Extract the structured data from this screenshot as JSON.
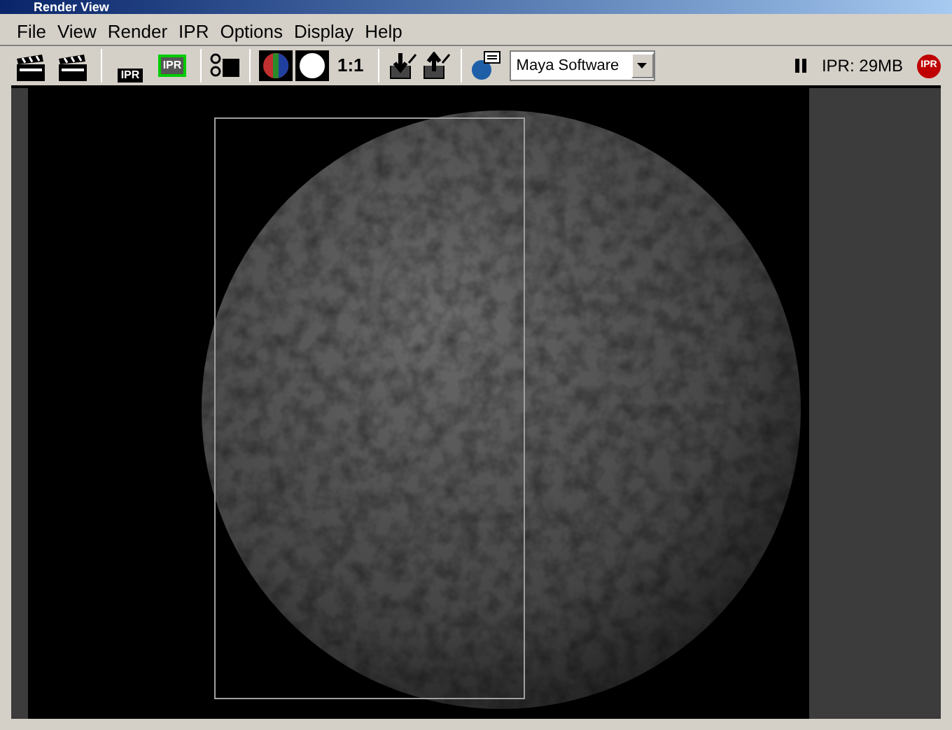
{
  "window": {
    "title": "Render View"
  },
  "menu": [
    "File",
    "View",
    "Render",
    "IPR",
    "Options",
    "Display",
    "Help"
  ],
  "toolbar": {
    "ipr_icon_labels": [
      "IPR",
      "IPR"
    ],
    "real_size_label": "1:1",
    "renderer": "Maya Software",
    "ipr_status": "IPR: 29MB",
    "ipr_stop_label": "IPR"
  }
}
